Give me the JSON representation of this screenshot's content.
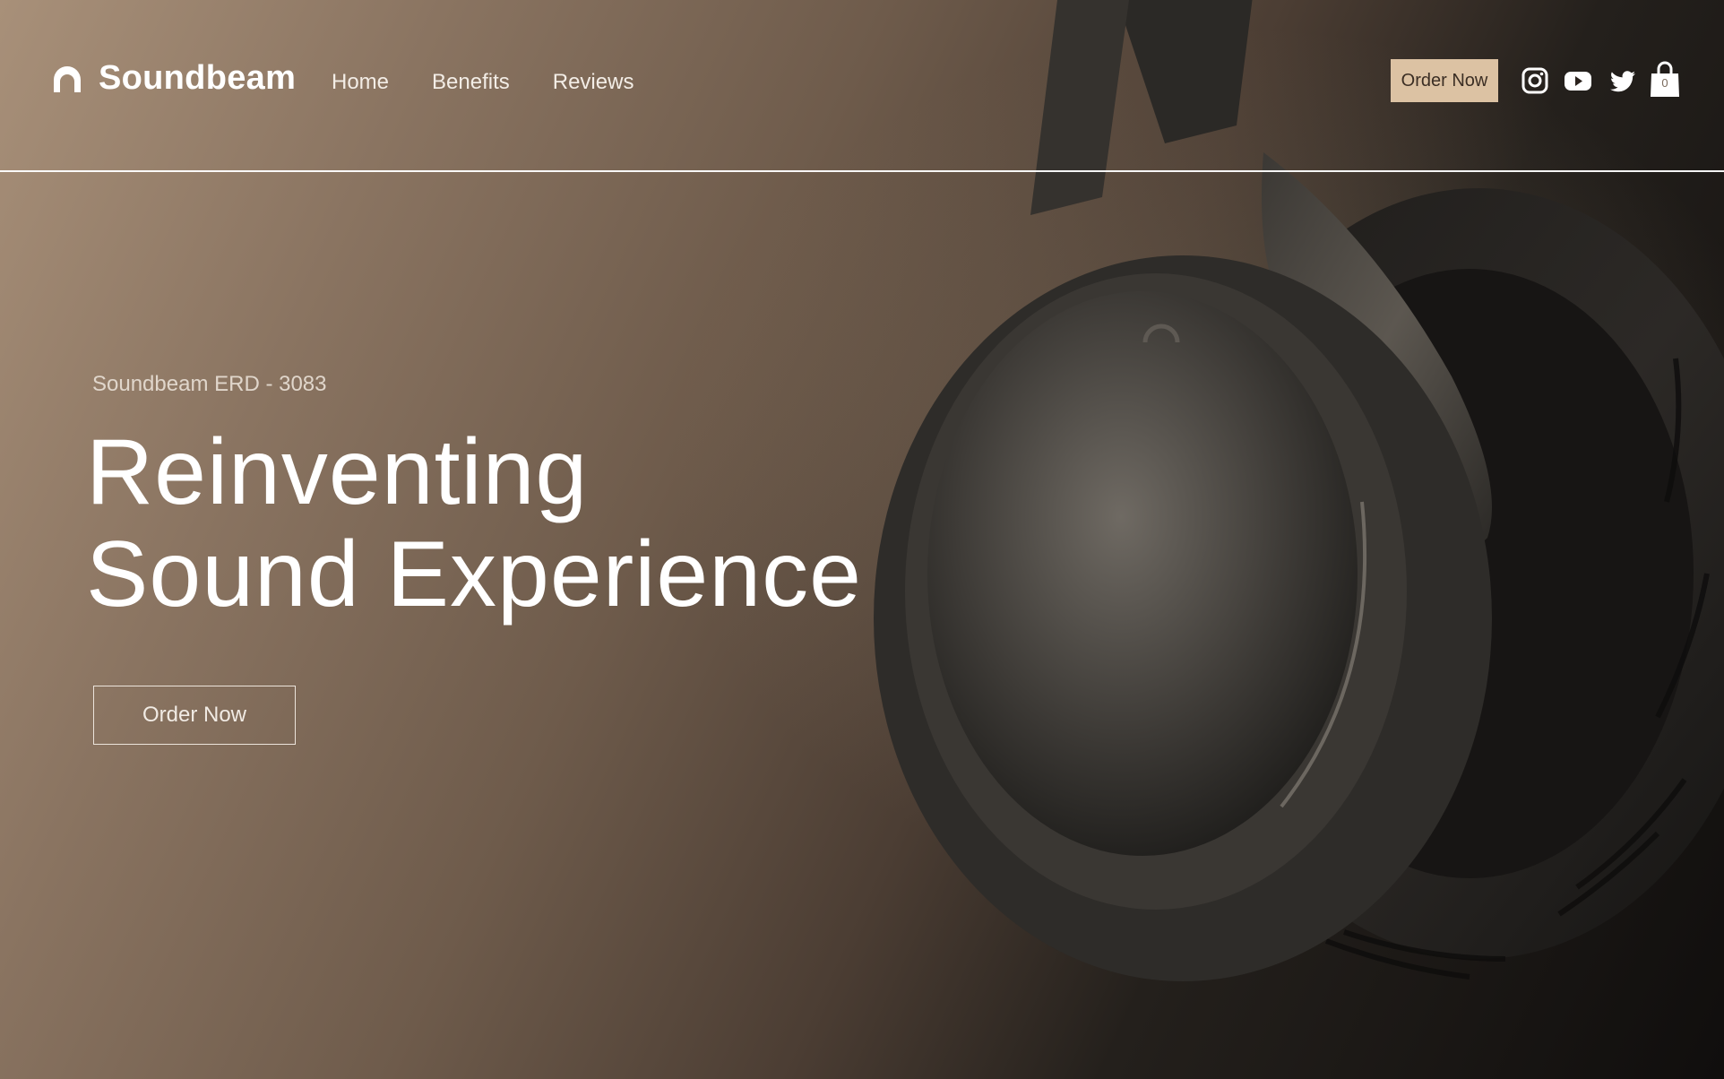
{
  "header": {
    "brand": "Soundbeam",
    "nav": [
      {
        "label": "Home"
      },
      {
        "label": "Benefits"
      },
      {
        "label": "Reviews"
      }
    ],
    "order_button": "Order Now",
    "social_icons": [
      "instagram-icon",
      "youtube-icon",
      "twitter-icon"
    ],
    "cart": {
      "icon": "shopping-bag-icon",
      "count": "0"
    }
  },
  "hero": {
    "model": "Soundbeam ERD - 3083",
    "headline_line1": "Reinventing",
    "headline_line2": "Sound Experience",
    "cta": "Order Now",
    "image": "headphones-photo"
  },
  "colors": {
    "accent_button": "#dcc2a3",
    "background_light": "#a89079",
    "background_dark": "#100e0d",
    "text": "#ffffff"
  }
}
